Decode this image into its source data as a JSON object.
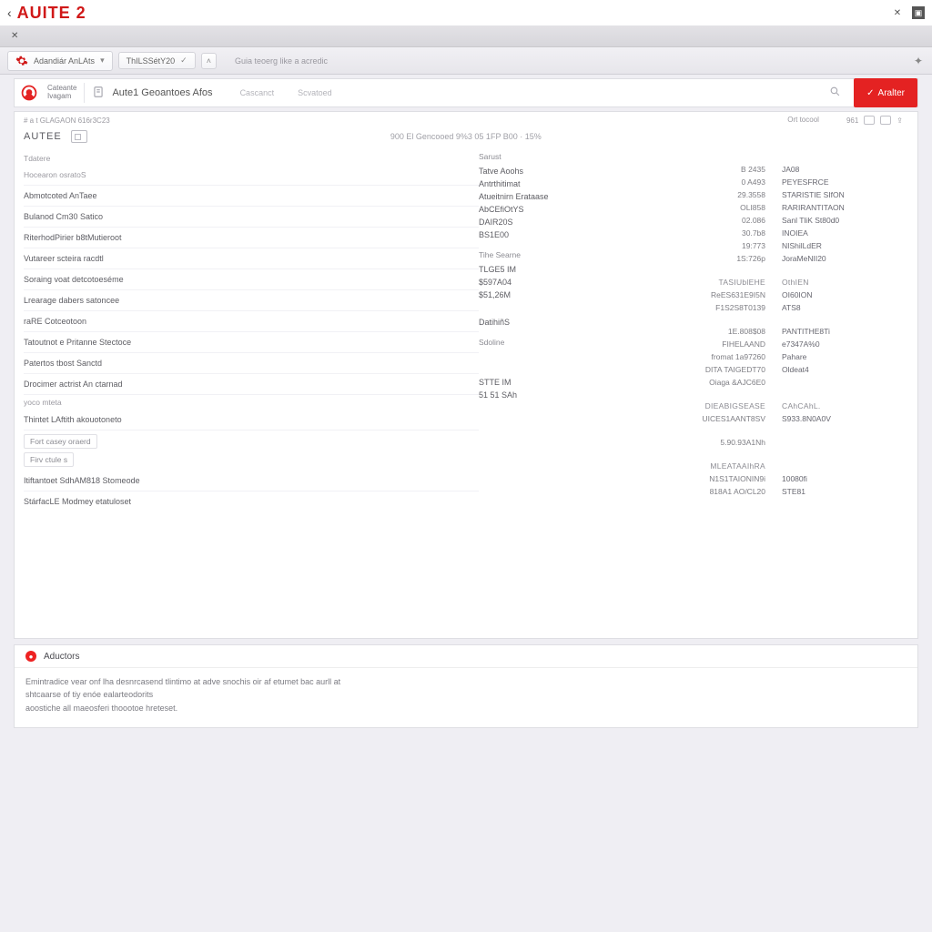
{
  "titlebar": {
    "brand": "AUITE 2"
  },
  "ribbon": {
    "chip1": "Adandiár AnLAts",
    "chip2": "ThILSSétY20",
    "helper": "Guia teoerg like a acredic"
  },
  "apphdr": {
    "org1": "Cateante",
    "org2": "Ivagam",
    "title": "Aute1 Geoantoes Afos",
    "tab1": "Cascanct",
    "tab2": "Scvatoed",
    "cta": "Aralter"
  },
  "panel": {
    "leftMeta": "# a t GLAGAON 616r3C23",
    "rightMeta1": "Ort tocool",
    "rightMeta2": "961",
    "sectionName": "AUTEE",
    "centerMeta": "900 El Gencooed 9%3 05 1FP B00 · 15%"
  },
  "col1": {
    "g0": "Tdatere",
    "r0": "Hocearon osratoS",
    "r1": "Abmotcoted AnTaee",
    "r2": "Bulanod Cm30 Satico",
    "r3": "RiterhodPirier b8tMutieroot",
    "r4": "Vutareer scteira racdtl",
    "r5": "Soraing voat detcotoeséme",
    "r6": "Lrearage dabers satoncee",
    "r7": "raRE Cotceotoon",
    "r8": "Tatoutnot e Pritanne Stectoce",
    "r9": "Patertos tbost Sanctd",
    "r10": "Drocimer actrist An ctarnad",
    "r10b": "yoco mteta",
    "r11": "Thintet LAftith akouotoneto",
    "pill1": "Fort casey oraerd",
    "pill2": "Firv ctule s",
    "r12": "Itiftantoet SdhAM818 Stomeode",
    "r13": "StárfacLE Modmey etatuloset"
  },
  "col2": {
    "h0": "Sarust",
    "v0a": "Tatve Aoohs",
    "v0b": "Antrthitimat",
    "v0c": "Atueitnirn Erataase",
    "v0d": "AbCEfiOtYS",
    "v0e": "DAIR20S",
    "v0f": "BS1E00",
    "h1": "Tihe Searne",
    "v1a": "TLGE5 IM",
    "v1b": "$597A04",
    "v1c": "$51,26M",
    "v1d": "DatihiñS",
    "h2": "Sdoline",
    "v2a": "STTE IM",
    "v2b": "51 51 SAh"
  },
  "col3": {
    "r0a": "B 2435",
    "r0b": "JA08",
    "r1a": "0 A493",
    "r1b": "PEYESFRCE",
    "r2a": "29.3558",
    "r2b": "STARISTIE SIfON",
    "r3a": "OLI858",
    "r3b": "RARIRANTITAON",
    "r4a": "02.086",
    "r4b": "Sanl TliK St80d0",
    "r5a": "30.7b8",
    "r5b": "INOIEA",
    "r6a": "19:773",
    "r6b": "NIShilLdER",
    "r7a": "1S:726p",
    "r7b": "JoraMeNII20",
    "r8a": "TASIUblEHE",
    "r8b": "OthIEN",
    "r9a": "ReES631E9I5N",
    "r9b": "OI60ION",
    "r10a": "F1S2S8T0139",
    "r10b": "ATS8",
    "r11a": "1E.808$08",
    "r11b": "PANTITHE8Ti",
    "r12a": "FIHELAAND",
    "r12b": "e7347A%0",
    "r13a": "fromat 1a97260",
    "r13b": "Pahare",
    "r14a": "DITA TAIGEDT70",
    "r14b": "Oldeat4",
    "r15a": "Oiaga &AJC6E0",
    "r15b": "",
    "r16a": "DIEABIGSEASE",
    "r16b": "CAhCAhL.",
    "r17a": "UICES1AANT8SV",
    "r17b": "S933.8N0A0V",
    "r18a": "5.90.93A1Nh",
    "r18b": "",
    "r19a": "MLEATAAIhRA",
    "r19b": "",
    "r20a": "N1S1TAIONIN9i",
    "r20b": "10080fi",
    "r21a": "818A1 AO/CL20",
    "r21b": "STE81"
  },
  "notice": {
    "title": "Aductors",
    "l1": "Emintradice vear onf lha desnrcasend tlintimo at adve snochis oir af etumet bac aurll at",
    "l2": "shtcaarse of tiy enóe ealarteodorits",
    "l3": "aoostiche all maeosferi thoootoe hreteset."
  }
}
